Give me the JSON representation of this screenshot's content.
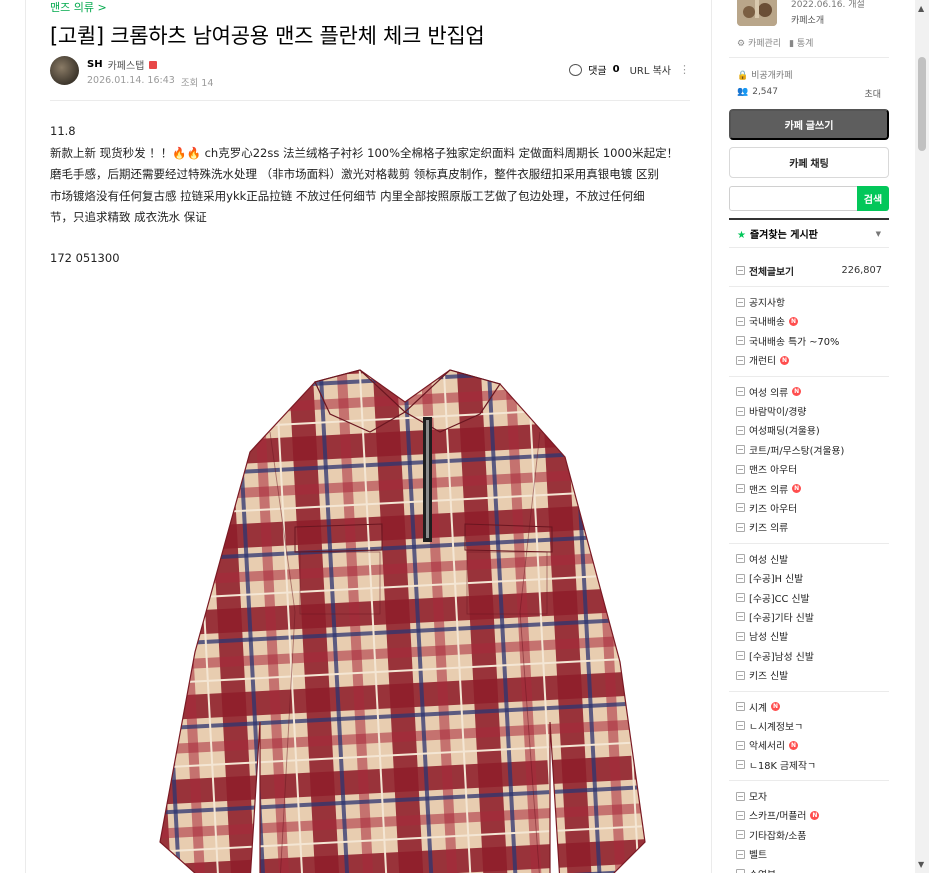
{
  "article": {
    "board_link": "맨즈 의류 >",
    "title": "[고퀼] 크롬하츠 남여공용 맨즈 플란체 체크 반집업",
    "author": {
      "name": "SH",
      "grade": "카페스탭"
    },
    "date": "2026.01.14. 16:43",
    "views": "조회 14",
    "tools": {
      "comment_label": "댓글",
      "comment_count": "0",
      "url_copy": "URL 복사"
    },
    "body_lines": [
      "11.8",
      "新款上新 现货秒发 ！！🔥🔥 ch克罗心22ss 法兰绒格子衬衫 100%全棉格子独家定织面料 定做面料周期长 1000米起定！",
      "磨毛手感，后期还需要经过特殊洗水处理 （非市场面料）激光对格裁剪 领标真皮制作，整件衣服纽扣采用真银电镀 区别",
      "市场镀烙没有任何复古感 拉链采用ykk正品拉链 不放过任何细节 内里全部按照原版工艺做了包边处理，不放过任何细",
      "节，只追求精致 成衣洗水 保证"
    ],
    "price_line": "172 051300"
  },
  "sidebar": {
    "cafe_open_date": "2022.06.16. 개설",
    "cafe_intro": "카페소개",
    "cafe_manage": "카페관리",
    "cafe_stats": "통계",
    "cafe_public": "비공개카페",
    "member_count": "2,547",
    "invite": "초대",
    "write_button": "카페 글쓰기",
    "chat_button": "카페 채팅",
    "search_placeholder": "",
    "search_button": "검색",
    "fav_boards": "즐겨찾는 게시판",
    "all_posts": {
      "label": "전체글보기",
      "count": "226,807"
    },
    "menu_groups": [
      [
        {
          "label": "공지사항",
          "new": false
        },
        {
          "label": "국내배송",
          "new": true
        },
        {
          "label": "국내배송 특가 ~70%",
          "new": false
        },
        {
          "label": "개런티",
          "new": true
        }
      ],
      [
        {
          "label": "여성 의류",
          "new": true
        },
        {
          "label": "바람막이/경량",
          "new": false
        },
        {
          "label": "여성패딩(겨울용)",
          "new": false
        },
        {
          "label": "코트/퍼/무스탕(겨울용)",
          "new": false
        },
        {
          "label": "맨즈 아우터",
          "new": false
        },
        {
          "label": "맨즈 의류",
          "new": true
        },
        {
          "label": "키즈 아우터",
          "new": false
        },
        {
          "label": "키즈 의류",
          "new": false
        }
      ],
      [
        {
          "label": "여성 신발",
          "new": false
        },
        {
          "label": "[수공]H 신발",
          "new": false
        },
        {
          "label": "[수공]CC 신발",
          "new": false
        },
        {
          "label": "[수공]기타 신발",
          "new": false
        },
        {
          "label": "남성 신발",
          "new": false
        },
        {
          "label": "[수공]남성 신발",
          "new": false
        },
        {
          "label": "키즈 신발",
          "new": false
        }
      ],
      [
        {
          "label": "시계",
          "new": true
        },
        {
          "label": "ㄴ시계정보ㄱ",
          "new": false
        },
        {
          "label": "악세서리",
          "new": true
        },
        {
          "label": "ㄴ18K 금제작ㄱ",
          "new": false
        }
      ],
      [
        {
          "label": "모자",
          "new": false
        },
        {
          "label": "스카프/머플러",
          "new": true
        },
        {
          "label": "기타잡화/소품",
          "new": false
        },
        {
          "label": "벨트",
          "new": false
        },
        {
          "label": "수영복",
          "new": false
        }
      ]
    ],
    "new_badge": "N"
  },
  "colors": {
    "accent_green": "#03c75a",
    "link_green": "#03a94d",
    "new_badge_red": "#ff4e4e",
    "shirt_red": "#8e1e2a",
    "shirt_beige": "#e8cdb0",
    "shirt_navy": "#2c3470"
  }
}
